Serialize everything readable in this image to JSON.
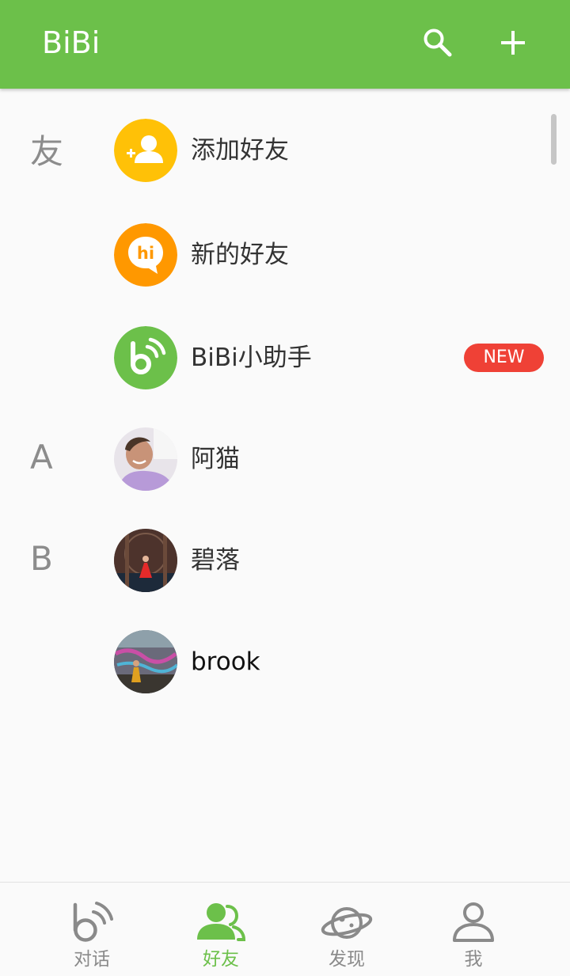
{
  "appbar": {
    "title": "BiBi",
    "search_icon": "search-icon",
    "add_icon": "plus-icon",
    "color": "#6cc04a"
  },
  "contacts": {
    "sections": [
      {
        "letter": "友"
      },
      {
        "letter": "A"
      },
      {
        "letter": "B"
      }
    ],
    "items": [
      {
        "label": "添加好友",
        "icon": "add-friend-icon",
        "avatar_color": "#ffc107"
      },
      {
        "label": "新的好友",
        "icon": "hi-chat-icon",
        "avatar_color": "#ff9800"
      },
      {
        "label": "BiBi小助手",
        "icon": "bibi-logo-icon",
        "avatar_color": "#6cc04a",
        "badge": "NEW"
      },
      {
        "label": "阿猫",
        "icon": "user-photo"
      },
      {
        "label": "碧落",
        "icon": "user-photo"
      },
      {
        "label": "brook",
        "icon": "user-photo"
      }
    ],
    "badge_color": "#ef4136"
  },
  "bottom_nav": {
    "active_color": "#6cc04a",
    "inactive_color": "#8a8a8a",
    "tabs": [
      {
        "label": "对话",
        "icon": "chat-bubble-icon",
        "active": false
      },
      {
        "label": "好友",
        "icon": "friends-icon",
        "active": true
      },
      {
        "label": "发现",
        "icon": "planet-icon",
        "active": false
      },
      {
        "label": "我",
        "icon": "profile-icon",
        "active": false
      }
    ]
  }
}
